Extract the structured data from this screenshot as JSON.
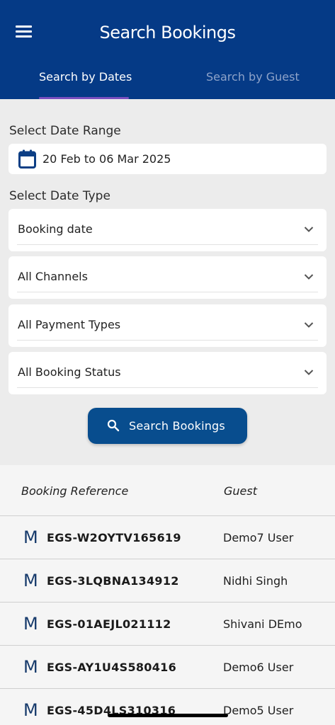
{
  "header": {
    "title": "Search Bookings",
    "tabs": [
      {
        "label": "Search by Dates",
        "active": true
      },
      {
        "label": "Search by Guest",
        "active": false
      }
    ]
  },
  "date_range": {
    "label": "Select Date Range",
    "value": "20 Feb to 06 Mar 2025"
  },
  "date_type": {
    "label": "Select Date Type"
  },
  "filters": [
    {
      "value": "Booking date"
    },
    {
      "value": "All Channels"
    },
    {
      "value": "All Payment Types"
    },
    {
      "value": "All Booking Status"
    }
  ],
  "search_button": {
    "label": "Search Bookings"
  },
  "table": {
    "columns": [
      "Booking Reference",
      "Guest"
    ],
    "rows": [
      {
        "icon": "M",
        "reference": "EGS-W2OYTV165619",
        "guest": "Demo7 User"
      },
      {
        "icon": "M",
        "reference": "EGS-3LQBNA134912",
        "guest": "Nidhi Singh"
      },
      {
        "icon": "M",
        "reference": "EGS-01AEJL021112",
        "guest": "Shivani DEmo"
      },
      {
        "icon": "M",
        "reference": "EGS-AY1U4S580416",
        "guest": "Demo6 User"
      },
      {
        "icon": "M",
        "reference": "EGS-45D4LS310316",
        "guest": "Demo5 User"
      }
    ]
  },
  "colors": {
    "header_bg": "#053a86",
    "accent_underline": "#7a4fbf",
    "button_bg": "#084d8e",
    "channel_icon": "#163a6b"
  },
  "icons": {
    "menu": "menu-icon",
    "calendar": "calendar-icon",
    "chevron": "chevron-down-icon",
    "search": "search-icon"
  }
}
